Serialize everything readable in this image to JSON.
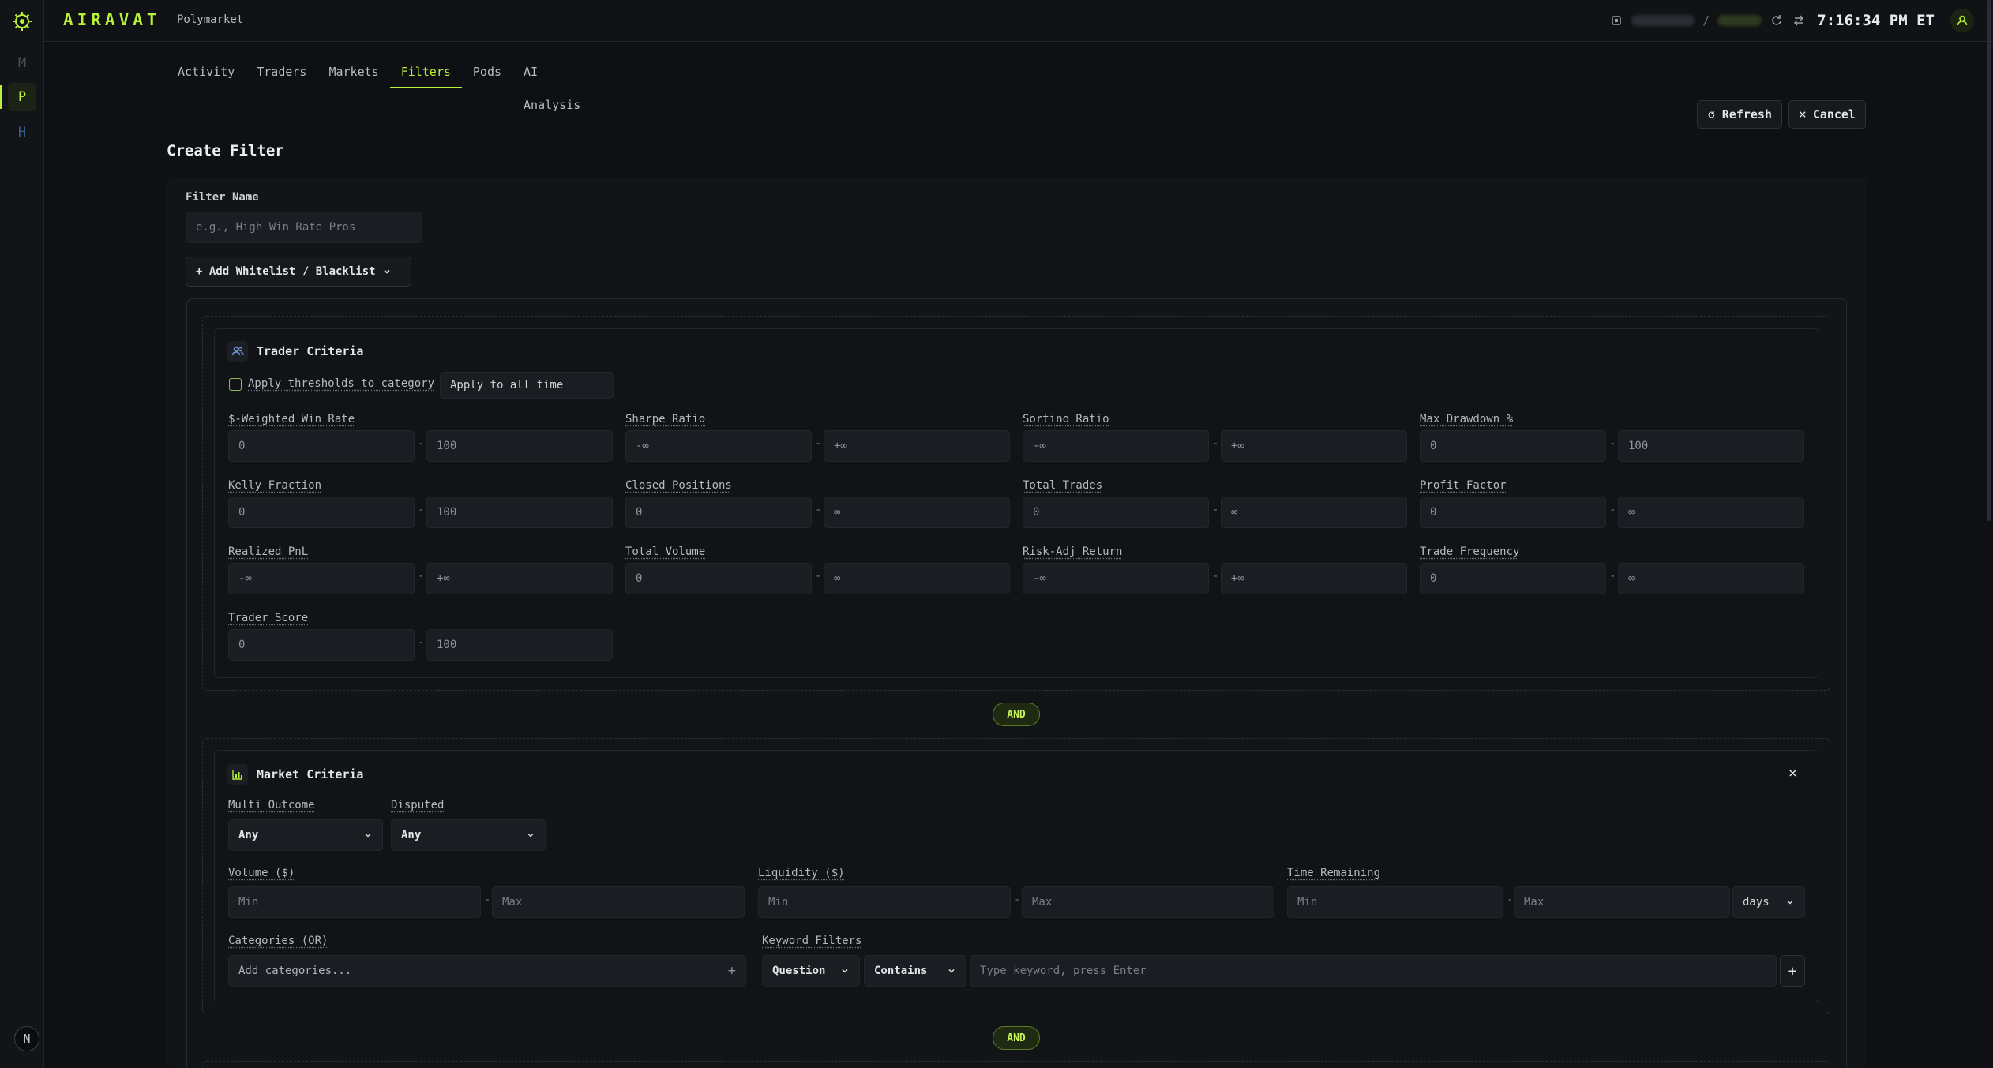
{
  "app": {
    "brand": "AIRAVAT",
    "section": "Polymarket",
    "clock": "7:16:34 PM ET",
    "separator": "/"
  },
  "rail": {
    "items": [
      "M",
      "P",
      "H"
    ],
    "bottom": "N"
  },
  "tabs": [
    "Activity",
    "Traders",
    "Markets",
    "Filters",
    "Pods",
    "AI Analysis"
  ],
  "actions": {
    "refresh": "Refresh",
    "cancel": "Cancel"
  },
  "page": {
    "title": "Create Filter"
  },
  "form": {
    "name_label": "Filter Name",
    "name_placeholder": "e.g., High Win Rate Pros",
    "add_list_label": "+ Add Whitelist / Blacklist"
  },
  "trader_criteria": {
    "title": "Trader Criteria",
    "apply_category_label": "Apply thresholds to category",
    "time_scope": "Apply to all time",
    "fields": [
      {
        "label": "$-Weighted Win Rate",
        "min": "0",
        "max": "100"
      },
      {
        "label": "Sharpe Ratio",
        "min": "-∞",
        "max": "+∞"
      },
      {
        "label": "Sortino Ratio",
        "min": "-∞",
        "max": "+∞"
      },
      {
        "label": "Max Drawdown %",
        "min": "0",
        "max": "100"
      },
      {
        "label": "Kelly Fraction",
        "min": "0",
        "max": "100"
      },
      {
        "label": "Closed Positions",
        "min": "0",
        "max": "∞"
      },
      {
        "label": "Total Trades",
        "min": "0",
        "max": "∞"
      },
      {
        "label": "Profit Factor",
        "min": "0",
        "max": "∞"
      },
      {
        "label": "Realized PnL",
        "min": "-∞",
        "max": "+∞"
      },
      {
        "label": "Total Volume",
        "min": "0",
        "max": "∞"
      },
      {
        "label": "Risk-Adj Return",
        "min": "-∞",
        "max": "+∞"
      },
      {
        "label": "Trade Frequency",
        "min": "0",
        "max": "∞"
      },
      {
        "label": "Trader Score",
        "min": "0",
        "max": "100"
      }
    ],
    "range_separator": "-"
  },
  "and_label": "AND",
  "market_criteria": {
    "title": "Market Criteria",
    "close": "×",
    "multi_outcome_label": "Multi Outcome",
    "multi_outcome_value": "Any",
    "disputed_label": "Disputed",
    "disputed_value": "Any",
    "volume_label": "Volume ($)",
    "liquidity_label": "Liquidity ($)",
    "time_remaining_label": "Time Remaining",
    "min_placeholder": "Min",
    "max_placeholder": "Max",
    "time_unit": "days",
    "categories_label": "Categories (OR)",
    "categories_placeholder": "Add categories...",
    "keyword_label": "Keyword Filters",
    "keyword_field": "Question",
    "keyword_op": "Contains",
    "keyword_placeholder": "Type keyword, press Enter",
    "add_symbol": "+"
  }
}
